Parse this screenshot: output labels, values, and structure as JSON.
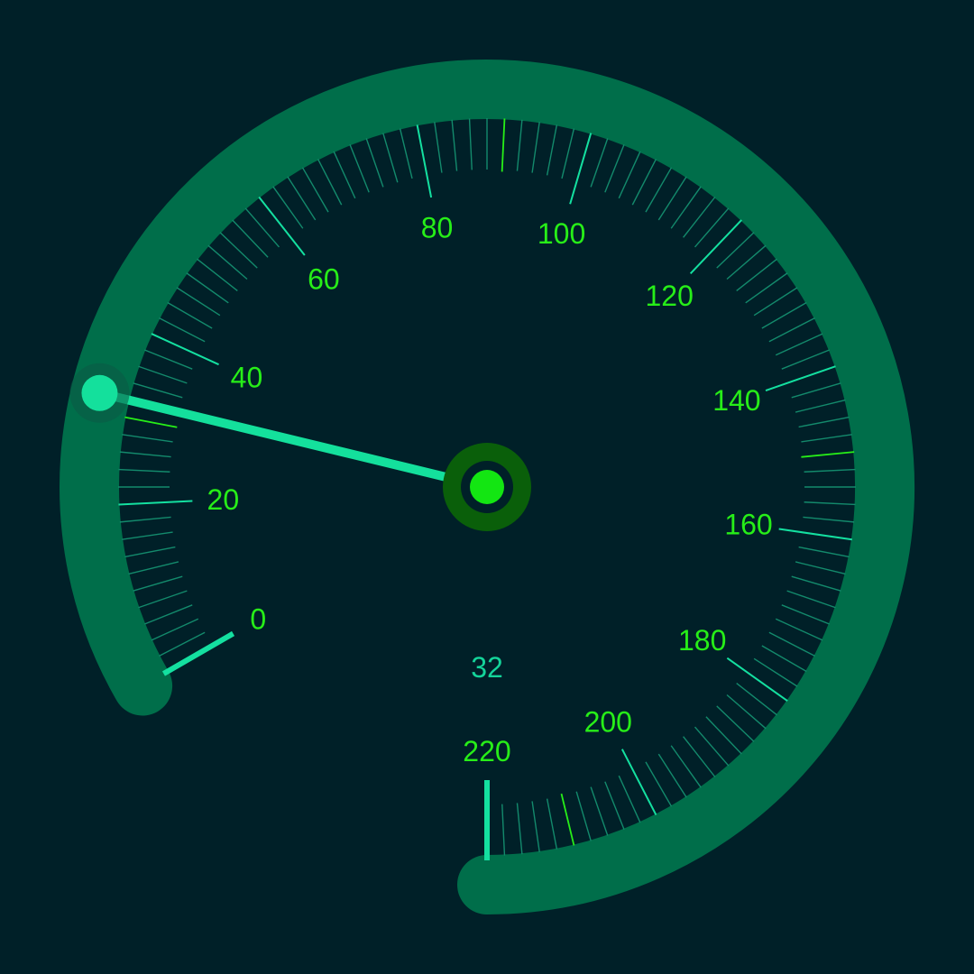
{
  "gauge": {
    "value": 32,
    "value_text": "32",
    "min": 0,
    "max": 220,
    "major_step": 20,
    "minor_step": 2,
    "tick_labels": [
      "0",
      "20",
      "40",
      "60",
      "80",
      "100",
      "120",
      "140",
      "160",
      "180",
      "200",
      "220"
    ],
    "highlight_ticks": [
      30,
      90,
      150,
      210
    ]
  },
  "colors": {
    "background": "#002028",
    "arc": "#006e4a",
    "major_tick": "#14e0a0",
    "minor_tick": "#138a6c",
    "highlight_tick": "#27ee18",
    "label": "#27ee18",
    "needle": "#14e09c",
    "needle_tip_halo": "#0b5a46",
    "hub_ring": "#0a5f0a",
    "hub_center": "#13e612",
    "value_text": "#14d49a"
  }
}
